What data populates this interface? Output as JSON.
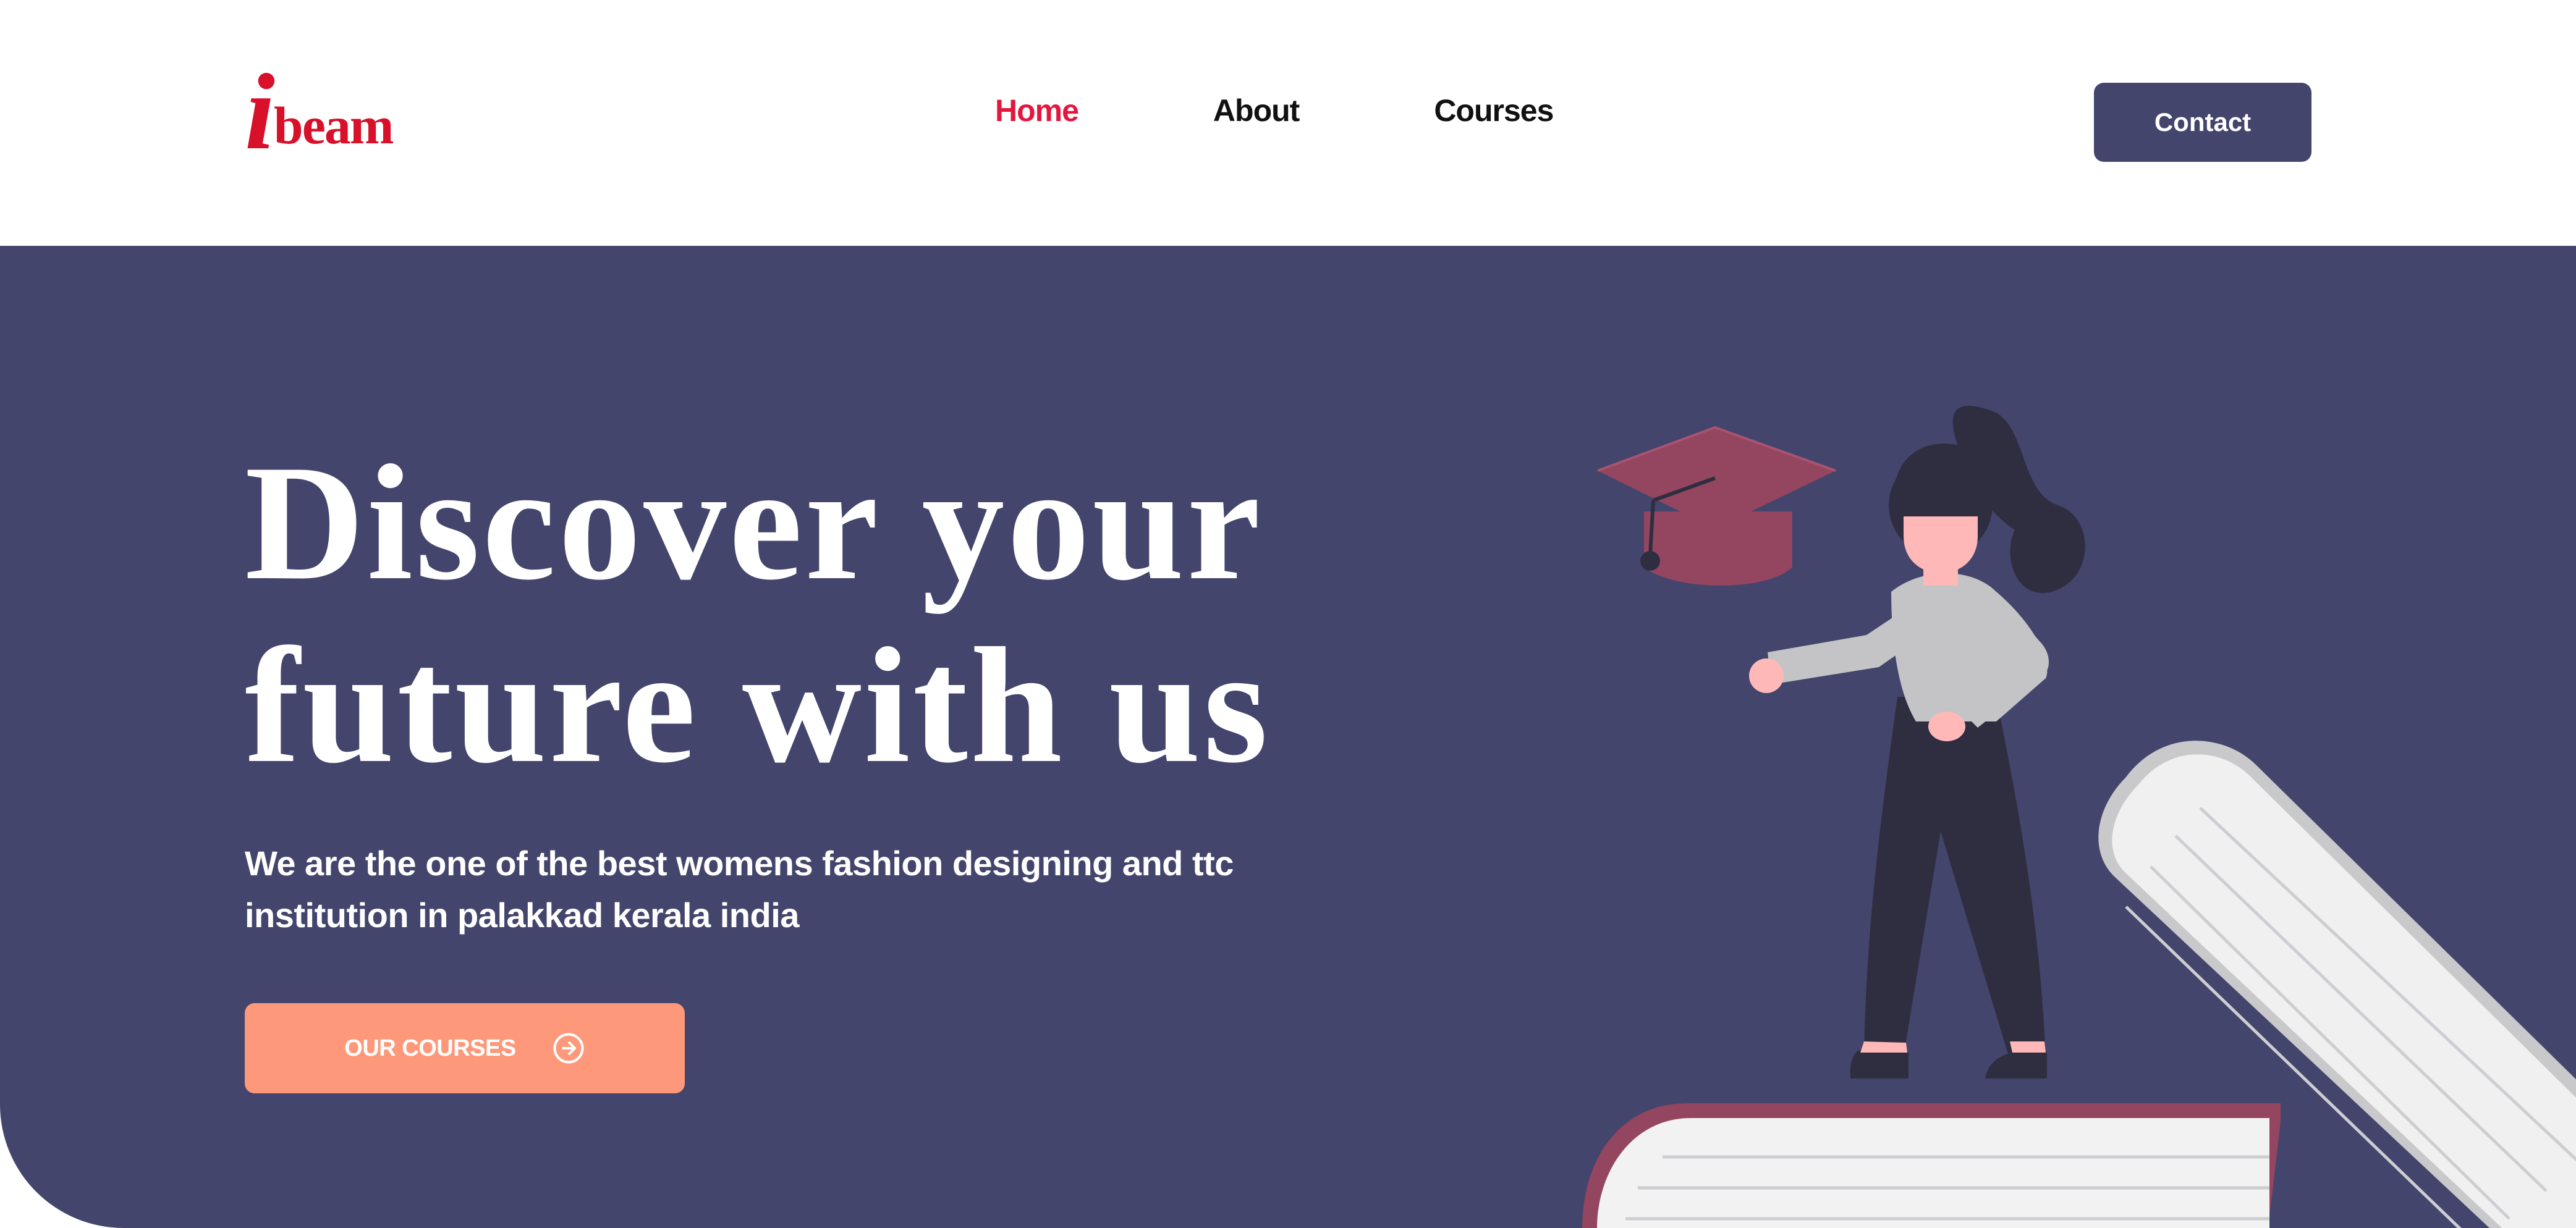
{
  "logo": {
    "initial": "i",
    "rest": "beam"
  },
  "nav": {
    "items": [
      {
        "label": "Home",
        "active": true
      },
      {
        "label": "About",
        "active": false
      },
      {
        "label": "Courses",
        "active": false
      }
    ]
  },
  "header": {
    "contact_label": "Contact"
  },
  "hero": {
    "title_line1": "Discover your",
    "title_line2": "future with us",
    "subtitle": "We are the one of the best womens fashion designing and ttc institution in palakkad kerala india",
    "cta_label": "OUR COURSES",
    "cta_icon": "arrow-right-circle-icon"
  },
  "illustration": {
    "name": "graduate-woman-on-books"
  },
  "colors": {
    "brand_red": "#d8102a",
    "nav_active": "#e3173e",
    "primary": "#43456c",
    "cta": "#fd997a",
    "text_dark": "#111111",
    "white": "#ffffff"
  }
}
